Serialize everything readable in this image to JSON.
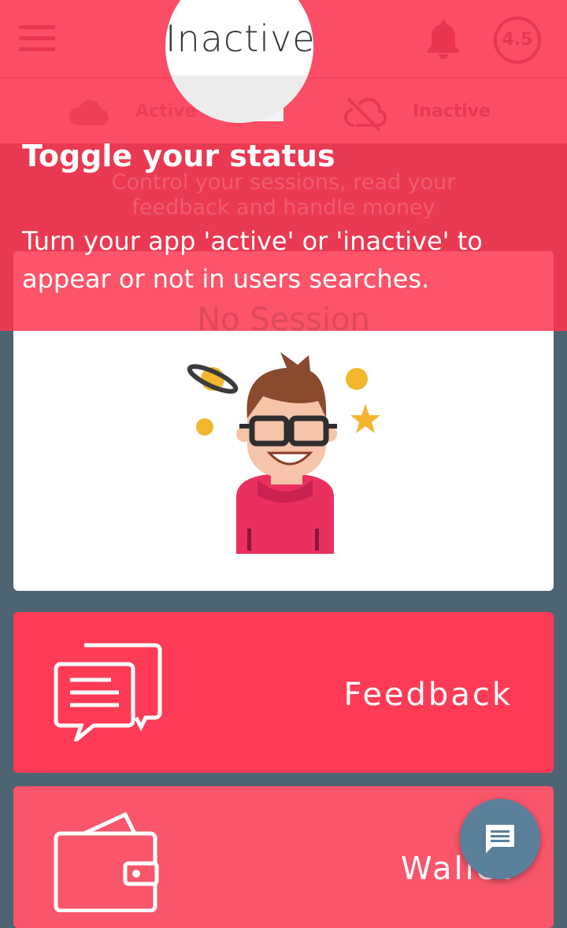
{
  "header": {
    "menu_icon": "hamburger-menu-icon",
    "bell_icon": "bell-icon",
    "rating": "4.5"
  },
  "tabs": {
    "active_label": "Active",
    "inactive_label": "Inactive"
  },
  "spotlight": {
    "label": "Inactive"
  },
  "header_sub": "Control your sessions, read your feedback and handle money",
  "tour": {
    "title": "Toggle your status",
    "body": "Turn your app 'active' or 'inactive' to appear or not in users searches."
  },
  "session_card": {
    "title": "No Session",
    "illustration": "nerd-character-illustration"
  },
  "cards": {
    "feedback_label": "Feedback",
    "wallet_label": "Wallet"
  },
  "fab": {
    "icon": "chat-message-icon"
  },
  "colors": {
    "primary": "#fd3b56",
    "banner": "#ea3952",
    "background": "#4f6472",
    "fab": "#5a7f9b"
  }
}
